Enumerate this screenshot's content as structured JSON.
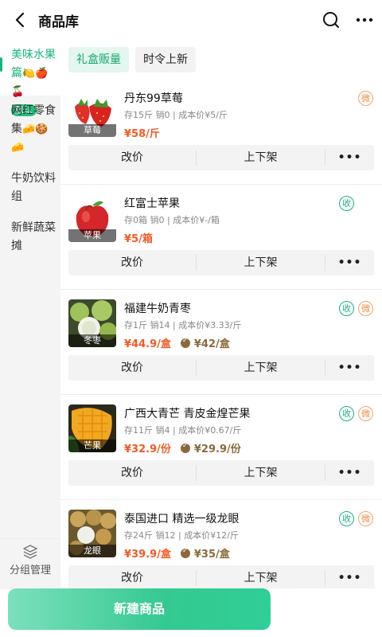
{
  "header": {
    "title": "商品库"
  },
  "sidebar": {
    "items": [
      {
        "label": "美味水果篇",
        "emoji": "🍋🍎🍒",
        "badge": "默认"
      },
      {
        "label": "网红零食集",
        "emoji": "🧀🍪🧀"
      },
      {
        "label": "牛奶饮料组"
      },
      {
        "label": "新鲜蔬菜摊"
      }
    ],
    "manage_label": "分组管理"
  },
  "tags": [
    {
      "label": "礼盒贩量"
    },
    {
      "label": "时令上新"
    }
  ],
  "products": [
    {
      "name": "丹东99草莓",
      "meta": "存15斤 销0 | 成本价¥5/斤",
      "price": "¥58/斤",
      "vip_price": "",
      "thumb_label": "草莓",
      "badges": [
        "微"
      ]
    },
    {
      "name": "红富士苹果",
      "meta": "存0箱 销0 | 成本价¥-/箱",
      "price": "¥5/箱",
      "vip_price": "",
      "thumb_label": "苹果",
      "badges": [
        "收"
      ]
    },
    {
      "name": "福建牛奶青枣",
      "meta": "存1斤 销14 | 成本价¥3.33/斤",
      "price": "¥44.9/盒",
      "vip_price": "¥42/盒",
      "thumb_label": "冬枣",
      "badges": [
        "收",
        "微"
      ]
    },
    {
      "name": "广西大青芒 青皮金煌芒果",
      "meta": "存11斤 销4 | 成本价¥0.67/斤",
      "price": "¥32.9/份",
      "vip_price": "¥29.9/份",
      "thumb_label": "芒果",
      "badges": [
        "收",
        "微"
      ]
    },
    {
      "name": "泰国进口 精选一级龙眼",
      "meta": "存24斤 销12 | 成本价¥12/斤",
      "price": "¥39.9/盒",
      "vip_price": "¥35/盒",
      "thumb_label": "龙眼",
      "badges": [
        "收",
        "微"
      ]
    }
  ],
  "actions": {
    "edit_price": "改价",
    "toggle_shelf": "上下架",
    "more": "•••"
  },
  "bottom": {
    "create_label": "新建商品"
  },
  "colors": {
    "accent": "#17b67b",
    "price": "#f15a24"
  }
}
